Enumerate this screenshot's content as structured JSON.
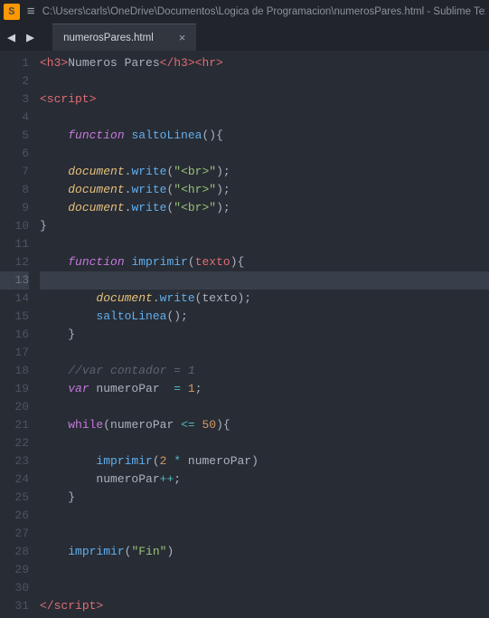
{
  "titlebar": {
    "icon_letter": "S",
    "menu_glyph": "≡",
    "path": "C:\\Users\\carls\\OneDrive\\Documentos\\Logica de Programacion\\numerosPares.html - Sublime Text"
  },
  "nav": {
    "back_glyph": "◀",
    "forward_glyph": "▶"
  },
  "tabs": [
    {
      "label": "numerosPares.html",
      "close_glyph": "×"
    }
  ],
  "active_line": 13,
  "code_lines": [
    {
      "n": 1,
      "tokens": [
        [
          "tag",
          "<h3>"
        ],
        [
          "plain",
          "Numeros Pares"
        ],
        [
          "tag",
          "</h3><hr>"
        ]
      ]
    },
    {
      "n": 2,
      "tokens": []
    },
    {
      "n": 3,
      "tokens": [
        [
          "tag",
          "<script>"
        ]
      ]
    },
    {
      "n": 4,
      "tokens": []
    },
    {
      "n": 5,
      "tokens": [
        [
          "plain",
          "    "
        ],
        [
          "key",
          "function"
        ],
        [
          "plain",
          " "
        ],
        [
          "fn",
          "saltoLinea"
        ],
        [
          "punc",
          "(){"
        ]
      ]
    },
    {
      "n": 6,
      "tokens": []
    },
    {
      "n": 7,
      "tokens": [
        [
          "plain",
          "    "
        ],
        [
          "var",
          "document"
        ],
        [
          "punc",
          "."
        ],
        [
          "fn",
          "write"
        ],
        [
          "punc",
          "("
        ],
        [
          "str",
          "\"<br>\""
        ],
        [
          "punc",
          ");"
        ]
      ]
    },
    {
      "n": 8,
      "tokens": [
        [
          "plain",
          "    "
        ],
        [
          "var",
          "document"
        ],
        [
          "punc",
          "."
        ],
        [
          "fn",
          "write"
        ],
        [
          "punc",
          "("
        ],
        [
          "str",
          "\"<hr>\""
        ],
        [
          "punc",
          ");"
        ]
      ]
    },
    {
      "n": 9,
      "tokens": [
        [
          "plain",
          "    "
        ],
        [
          "var",
          "document"
        ],
        [
          "punc",
          "."
        ],
        [
          "fn",
          "write"
        ],
        [
          "punc",
          "("
        ],
        [
          "str",
          "\"<br>\""
        ],
        [
          "punc",
          ");"
        ]
      ]
    },
    {
      "n": 10,
      "tokens": [
        [
          "punc",
          "}"
        ]
      ]
    },
    {
      "n": 11,
      "tokens": []
    },
    {
      "n": 12,
      "tokens": [
        [
          "plain",
          "    "
        ],
        [
          "key",
          "function"
        ],
        [
          "plain",
          " "
        ],
        [
          "fn",
          "imprimir"
        ],
        [
          "punc",
          "("
        ],
        [
          "varnorm",
          "texto"
        ],
        [
          "punc",
          "){"
        ]
      ]
    },
    {
      "n": 13,
      "tokens": []
    },
    {
      "n": 14,
      "tokens": [
        [
          "plain",
          "        "
        ],
        [
          "var",
          "document"
        ],
        [
          "punc",
          "."
        ],
        [
          "fn",
          "write"
        ],
        [
          "punc",
          "("
        ],
        [
          "plain",
          "texto"
        ],
        [
          "punc",
          ");"
        ]
      ]
    },
    {
      "n": 15,
      "tokens": [
        [
          "plain",
          "        "
        ],
        [
          "fn",
          "saltoLinea"
        ],
        [
          "punc",
          "();"
        ]
      ]
    },
    {
      "n": 16,
      "tokens": [
        [
          "plain",
          "    "
        ],
        [
          "punc",
          "}"
        ]
      ]
    },
    {
      "n": 17,
      "tokens": []
    },
    {
      "n": 18,
      "tokens": [
        [
          "plain",
          "    "
        ],
        [
          "com",
          "//var contador = 1"
        ]
      ]
    },
    {
      "n": 19,
      "tokens": [
        [
          "plain",
          "    "
        ],
        [
          "key",
          "var"
        ],
        [
          "plain",
          " numeroPar  "
        ],
        [
          "op",
          "="
        ],
        [
          "plain",
          " "
        ],
        [
          "num",
          "1"
        ],
        [
          "punc",
          ";"
        ]
      ]
    },
    {
      "n": 20,
      "tokens": []
    },
    {
      "n": 21,
      "tokens": [
        [
          "plain",
          "    "
        ],
        [
          "keynorm",
          "while"
        ],
        [
          "punc",
          "("
        ],
        [
          "plain",
          "numeroPar "
        ],
        [
          "op",
          "<="
        ],
        [
          "plain",
          " "
        ],
        [
          "num",
          "50"
        ],
        [
          "punc",
          "){"
        ]
      ]
    },
    {
      "n": 22,
      "tokens": []
    },
    {
      "n": 23,
      "tokens": [
        [
          "plain",
          "        "
        ],
        [
          "fn",
          "imprimir"
        ],
        [
          "punc",
          "("
        ],
        [
          "num",
          "2"
        ],
        [
          "plain",
          " "
        ],
        [
          "op",
          "*"
        ],
        [
          "plain",
          " numeroPar"
        ],
        [
          "punc",
          ")"
        ]
      ]
    },
    {
      "n": 24,
      "tokens": [
        [
          "plain",
          "        "
        ],
        [
          "plain",
          "numeroPar"
        ],
        [
          "op",
          "++"
        ],
        [
          "punc",
          ";"
        ]
      ]
    },
    {
      "n": 25,
      "tokens": [
        [
          "plain",
          "    "
        ],
        [
          "punc",
          "}"
        ]
      ]
    },
    {
      "n": 26,
      "tokens": []
    },
    {
      "n": 27,
      "tokens": []
    },
    {
      "n": 28,
      "tokens": [
        [
          "plain",
          "    "
        ],
        [
          "fn",
          "imprimir"
        ],
        [
          "punc",
          "("
        ],
        [
          "str",
          "\"Fin\""
        ],
        [
          "punc",
          ")"
        ]
      ]
    },
    {
      "n": 29,
      "tokens": []
    },
    {
      "n": 30,
      "tokens": []
    },
    {
      "n": 31,
      "tokens": [
        [
          "tag",
          "<"
        ],
        [
          "tag",
          "/script"
        ],
        [
          "tag",
          ">"
        ]
      ]
    }
  ]
}
